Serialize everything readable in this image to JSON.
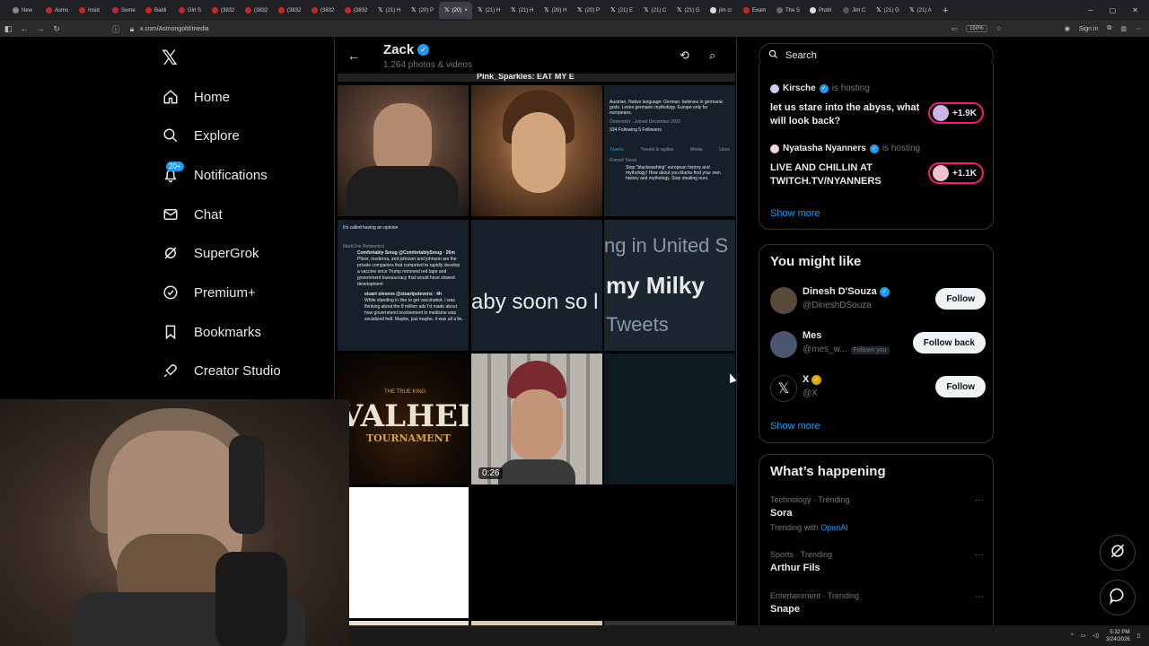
{
  "browser": {
    "tabs": [
      {
        "label": "New"
      },
      {
        "label": "Asmo"
      },
      {
        "label": "Insid"
      },
      {
        "label": "Some"
      },
      {
        "label": "Baldi"
      },
      {
        "label": "Girl S"
      },
      {
        "label": "(3832"
      },
      {
        "label": "(3832"
      },
      {
        "label": "(3832"
      },
      {
        "label": "(3832"
      },
      {
        "label": "(3832"
      },
      {
        "label": "(21) H"
      },
      {
        "label": "(20) P"
      },
      {
        "label": "(20)"
      },
      {
        "label": "(21) H"
      },
      {
        "label": "(21) H"
      },
      {
        "label": "(20) H"
      },
      {
        "label": "(20) P"
      },
      {
        "label": "(21) E"
      },
      {
        "label": "(21) C"
      },
      {
        "label": "(21) G"
      },
      {
        "label": "jim cr"
      },
      {
        "label": "Exam"
      },
      {
        "label": "The S"
      },
      {
        "label": "Probl"
      },
      {
        "label": "Jim C"
      },
      {
        "label": "(21) G"
      },
      {
        "label": "(21) A"
      }
    ],
    "url": "x.com/Asmongold/media",
    "zoom": "150%",
    "sign_in": "Sign in"
  },
  "sidebar": {
    "items": [
      {
        "label": "Home"
      },
      {
        "label": "Explore"
      },
      {
        "label": "Notifications",
        "badge": "20+"
      },
      {
        "label": "Chat"
      },
      {
        "label": "SuperGrok"
      },
      {
        "label": "Premium+"
      },
      {
        "label": "Bookmarks"
      },
      {
        "label": "Creator Studio"
      }
    ]
  },
  "profile_header": {
    "name": "Zack",
    "subtitle": "1,264 photos & videos"
  },
  "media": {
    "top_strip": "Pink_Sparkles: EAT MY E",
    "profile_shot": {
      "bio": "Austrian. Native language: German. believes in germanic gods. Loves germanic mythology. Europe only for europeans.",
      "location": "Österreich",
      "joined": "Joined December 2020",
      "following": "334 Following",
      "followers": "5 Followers",
      "tabs": [
        "Tweets",
        "Tweets & replies",
        "Media",
        "Likes"
      ],
      "pinned": "Pinned Tweet",
      "pinned_text": "Stop \"blackwashing\" european history and mythology! How about you blacks find your own history and mythology. Stop stealing ours."
    },
    "tweet_shot": {
      "top": "It's called having an opinion",
      "retweeted": "MarkOne Retweeted",
      "author": "Comfortably Smug @ComfortablySmug · 26m",
      "text": "Pfizer, moderna, and johnson and johnson are the private companies that competed to rapidly develop a vaccine once Trump removed red tape and government bureaucracy that would have slowed development",
      "author2": "stuart stevens @stuartpstevens · 4h",
      "text2": "While standing in line to get vaccinated, I was thinking about the 8 million ads I'd made about how government involvement in medicine was socialized hell. Maybe, just maybe, it was all a lie."
    },
    "text_frame_1": "aby soon so l",
    "text_frame_2": {
      "line1": "ng in United S",
      "line2": "my Milky",
      "line3": "Tweets"
    },
    "valheim": {
      "title": "VALHEIM",
      "kicker": "THE TRUE KING",
      "subtitle": "TOURNAMENT"
    },
    "video_duration": "0:26"
  },
  "right_panel": {
    "search_placeholder": "Search",
    "spaces": [
      {
        "host": "Kirsche",
        "status": "is hosting",
        "title": "let us stare into the abyss, what will look back?",
        "listeners": "+1.9K"
      },
      {
        "host": "Nyatasha Nyanners",
        "status": "is hosting",
        "title": "LIVE AND CHILLIN AT TWITCH.TV/NYANNERS",
        "listeners": "+1.1K"
      }
    ],
    "spaces_show_more": "Show more",
    "you_might_like": {
      "title": "You might like",
      "users": [
        {
          "name": "Dinesh D'Souza",
          "handle": "@DineshDSouza",
          "button": "Follow",
          "follows_you": "",
          "color": "#5a4a3a"
        },
        {
          "name": "Mes",
          "handle": "@mes_w...",
          "button": "Follow back",
          "follows_you": "Follows you",
          "color": "#4a5570"
        },
        {
          "name": "X",
          "handle": "@X",
          "button": "Follow",
          "follows_you": "",
          "color": "#000000"
        }
      ],
      "show_more": "Show more"
    },
    "whats_happening": {
      "title": "What’s happening",
      "trends": [
        {
          "meta": "Technology · Trending",
          "topic": "Sora",
          "with_label": "Trending with",
          "with_link": "OpenAI"
        },
        {
          "meta": "Sports · Trending",
          "topic": "Arthur Fils"
        },
        {
          "meta": "Entertainment · Trending",
          "topic": "Snape"
        }
      ]
    }
  },
  "taskbar": {
    "time": "5:32 PM",
    "date": "3/24/2026"
  },
  "colors": {
    "accent": "#1d9bf0",
    "live": "#f91880",
    "background": "#000000",
    "border": "#2f3336"
  }
}
